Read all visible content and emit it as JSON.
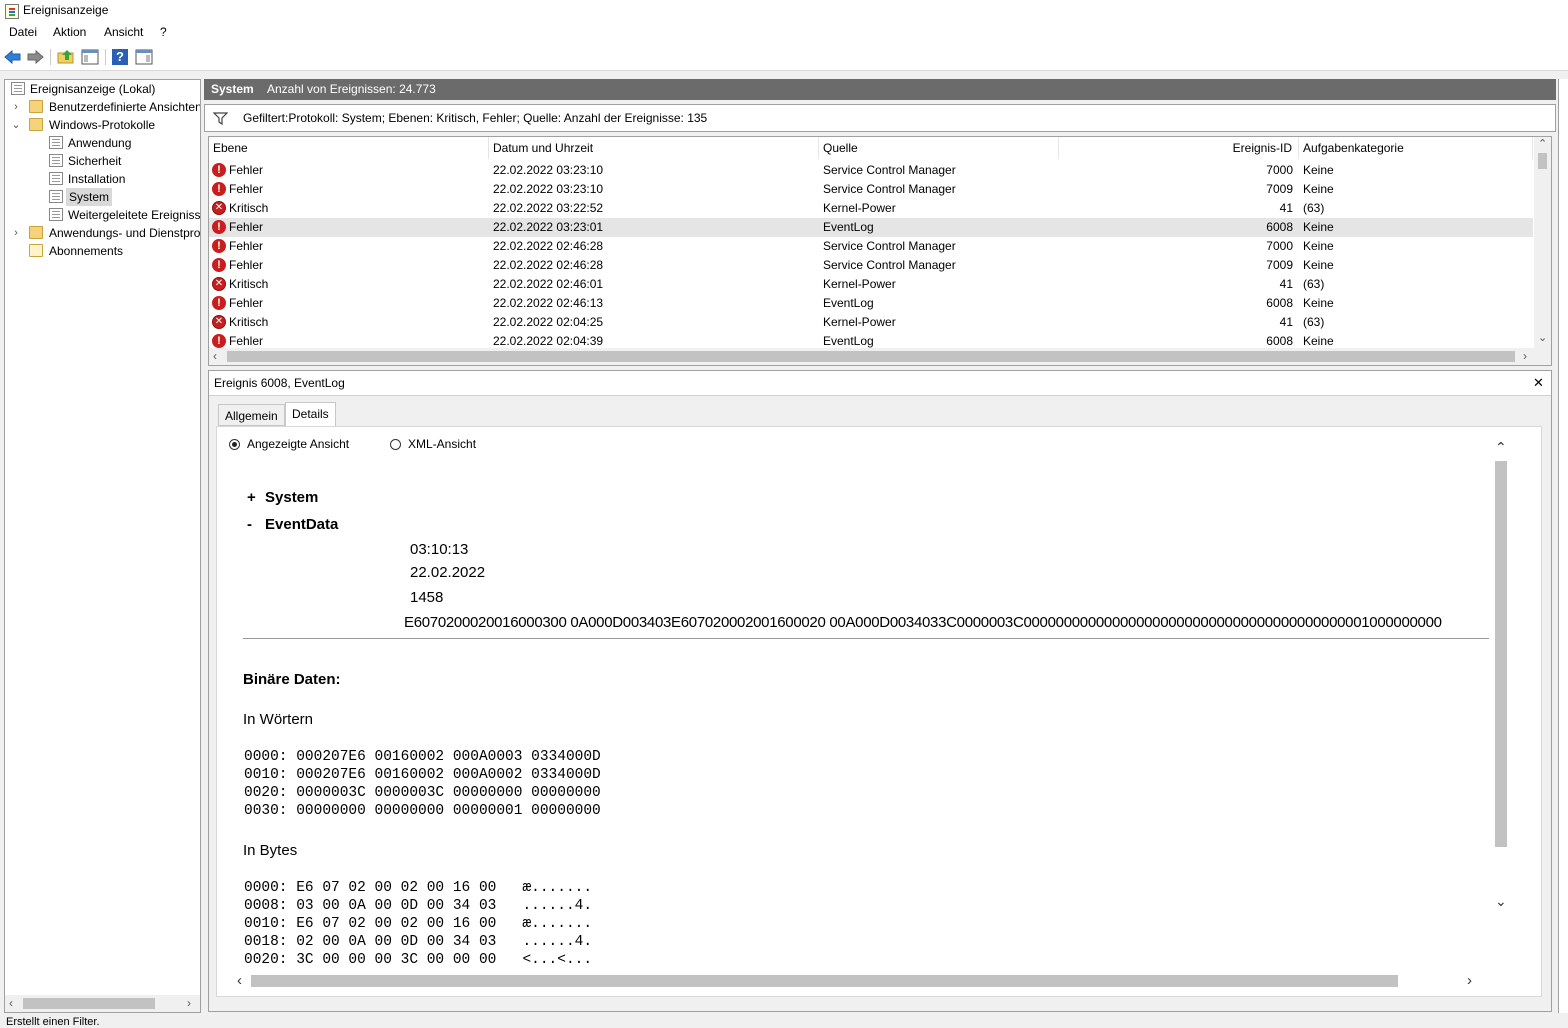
{
  "window": {
    "title": "Ereignisanzeige"
  },
  "menu": [
    "Datei",
    "Aktion",
    "Ansicht",
    "?"
  ],
  "toolbar": {
    "icons": [
      "back-arrow-icon",
      "forward-arrow-icon",
      "folder-up-icon",
      "show-hide-tree-icon",
      "help-icon",
      "show-hide-action-pane-icon"
    ],
    "help_glyph": "?"
  },
  "tree": {
    "items": [
      {
        "label": "Ereignisanzeige (Lokal)",
        "level": 0,
        "icon": "event-viewer-icon"
      },
      {
        "label": "Benutzerdefinierte Ansichten",
        "level": 1,
        "icon": "folder-icon",
        "expander": "collapsed"
      },
      {
        "label": "Windows-Protokolle",
        "level": 1,
        "icon": "folder-icon",
        "expander": "expanded"
      },
      {
        "label": "Anwendung",
        "level": 2,
        "icon": "log-icon"
      },
      {
        "label": "Sicherheit",
        "level": 2,
        "icon": "log-icon"
      },
      {
        "label": "Installation",
        "level": 2,
        "icon": "log-icon"
      },
      {
        "label": "System",
        "level": 2,
        "icon": "log-icon",
        "selected": true
      },
      {
        "label": "Weitergeleitete Ereignisse",
        "level": 2,
        "icon": "log-icon"
      },
      {
        "label": "Anwendungs- und Dienstprotokolle",
        "level": 1,
        "icon": "folder-icon",
        "expander": "collapsed"
      },
      {
        "label": "Abonnements",
        "level": 1,
        "icon": "subscriptions-icon"
      }
    ]
  },
  "list_header": {
    "log_name": "System",
    "count_text": "Anzahl von Ereignissen: 24.773"
  },
  "filter": {
    "text": "Gefiltert:Protokoll: System; Ebenen: Kritisch, Fehler; Quelle:  Anzahl der Ereignisse: 135"
  },
  "grid": {
    "columns": [
      "Ebene",
      "Datum und Uhrzeit",
      "Quelle",
      "Ereignis-ID",
      "Aufgabenkategorie"
    ],
    "rows": [
      {
        "level": "Fehler",
        "icon": "error",
        "datetime": "22.02.2022 03:23:10",
        "source": "Service Control Manager",
        "id": "7000",
        "category": "Keine"
      },
      {
        "level": "Fehler",
        "icon": "error",
        "datetime": "22.02.2022 03:23:10",
        "source": "Service Control Manager",
        "id": "7009",
        "category": "Keine"
      },
      {
        "level": "Kritisch",
        "icon": "critical",
        "datetime": "22.02.2022 03:22:52",
        "source": "Kernel-Power",
        "id": "41",
        "category": "(63)"
      },
      {
        "level": "Fehler",
        "icon": "error",
        "datetime": "22.02.2022 03:23:01",
        "source": "EventLog",
        "id": "6008",
        "category": "Keine",
        "selected": true
      },
      {
        "level": "Fehler",
        "icon": "error",
        "datetime": "22.02.2022 02:46:28",
        "source": "Service Control Manager",
        "id": "7000",
        "category": "Keine"
      },
      {
        "level": "Fehler",
        "icon": "error",
        "datetime": "22.02.2022 02:46:28",
        "source": "Service Control Manager",
        "id": "7009",
        "category": "Keine"
      },
      {
        "level": "Kritisch",
        "icon": "critical",
        "datetime": "22.02.2022 02:46:01",
        "source": "Kernel-Power",
        "id": "41",
        "category": "(63)"
      },
      {
        "level": "Fehler",
        "icon": "error",
        "datetime": "22.02.2022 02:46:13",
        "source": "EventLog",
        "id": "6008",
        "category": "Keine"
      },
      {
        "level": "Kritisch",
        "icon": "critical",
        "datetime": "22.02.2022 02:04:25",
        "source": "Kernel-Power",
        "id": "41",
        "category": "(63)"
      },
      {
        "level": "Fehler",
        "icon": "error",
        "datetime": "22.02.2022 02:04:39",
        "source": "EventLog",
        "id": "6008",
        "category": "Keine"
      }
    ],
    "icon_glyphs": {
      "error": "!",
      "critical": "✕"
    }
  },
  "detail": {
    "title": "Ereignis 6008, EventLog",
    "close_glyph": "✕",
    "tabs": [
      "Allgemein",
      "Details"
    ],
    "active_tab": "Details",
    "view_options": {
      "friendly": "Angezeigte Ansicht",
      "xml": "XML-Ansicht",
      "selected": "friendly"
    },
    "sections": {
      "system": {
        "toggle": "+",
        "label": "System"
      },
      "eventdata": {
        "toggle": "-",
        "label": "EventData"
      }
    },
    "event_data_values": [
      "03:10:13",
      "22.02.2022",
      "1458",
      "E6070200020016000300 0A000D003403E607020002001600020 00A000D0034033C0000003C0000000000000000000000000000000000000000001000000000"
    ],
    "binary": {
      "heading": "Binäre Daten:",
      "words_heading": "In Wörtern",
      "words": [
        "0000: 000207E6 00160002 000A0003 0334000D",
        "0010: 000207E6 00160002 000A0002 0334000D",
        "0020: 0000003C 0000003C 00000000 00000000",
        "0030: 00000000 00000000 00000001 00000000"
      ],
      "bytes_heading": "In Bytes",
      "bytes": [
        "0000: E6 07 02 00 02 00 16 00   æ.......",
        "0008: 03 00 0A 00 0D 00 34 03   ......4.",
        "0010: E6 07 02 00 02 00 16 00   æ.......",
        "0018: 02 00 0A 00 0D 00 34 03   ......4.",
        "0020: 3C 00 00 00 3C 00 00 00   <...<..."
      ]
    }
  },
  "statusbar": {
    "text": "Erstellt einen Filter."
  }
}
